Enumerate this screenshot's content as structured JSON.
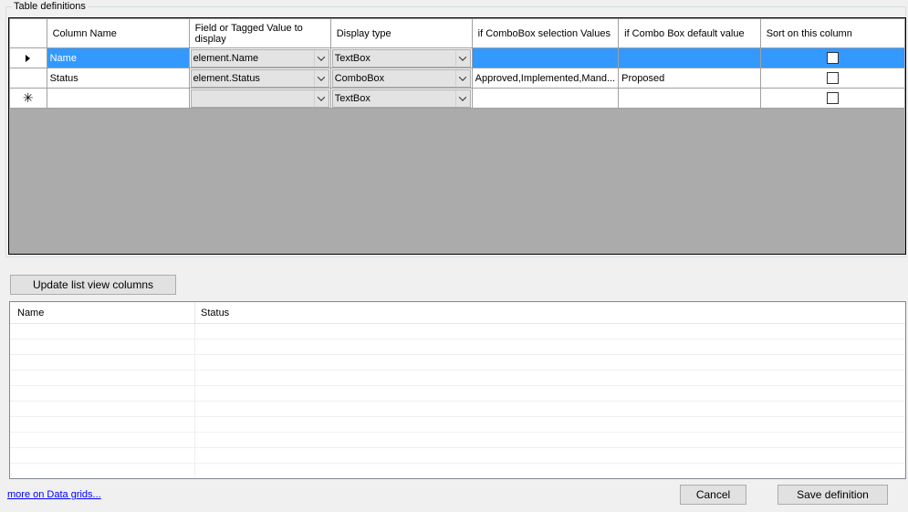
{
  "group": {
    "title": "Table definitions"
  },
  "grid": {
    "headers": {
      "column_name": "Column Name",
      "field": "Field or Tagged Value to display",
      "display_type": "Display type",
      "combo_values": "if ComboBox selection Values",
      "combo_default": "if Combo Box default value",
      "sort": "Sort on this column"
    },
    "rows": [
      {
        "column_name": "Name",
        "field": "element.Name",
        "display_type": "TextBox",
        "combo_values": "",
        "combo_default": "",
        "sort": false,
        "selected": true
      },
      {
        "column_name": "Status",
        "field": "element.Status",
        "display_type": "ComboBox",
        "combo_values": "Approved,Implemented,Mand...",
        "combo_default": "Proposed",
        "sort": false,
        "selected": false
      },
      {
        "column_name": "",
        "field": "",
        "display_type": "TextBox",
        "combo_values": "",
        "combo_default": "",
        "sort": false,
        "new_row": true
      }
    ],
    "new_row_marker": "✳"
  },
  "buttons": {
    "update": "Update list view columns",
    "cancel": "Cancel",
    "save": "Save definition"
  },
  "listview": {
    "columns": [
      "Name",
      "Status"
    ]
  },
  "link": {
    "text": "more on Data grids..."
  }
}
